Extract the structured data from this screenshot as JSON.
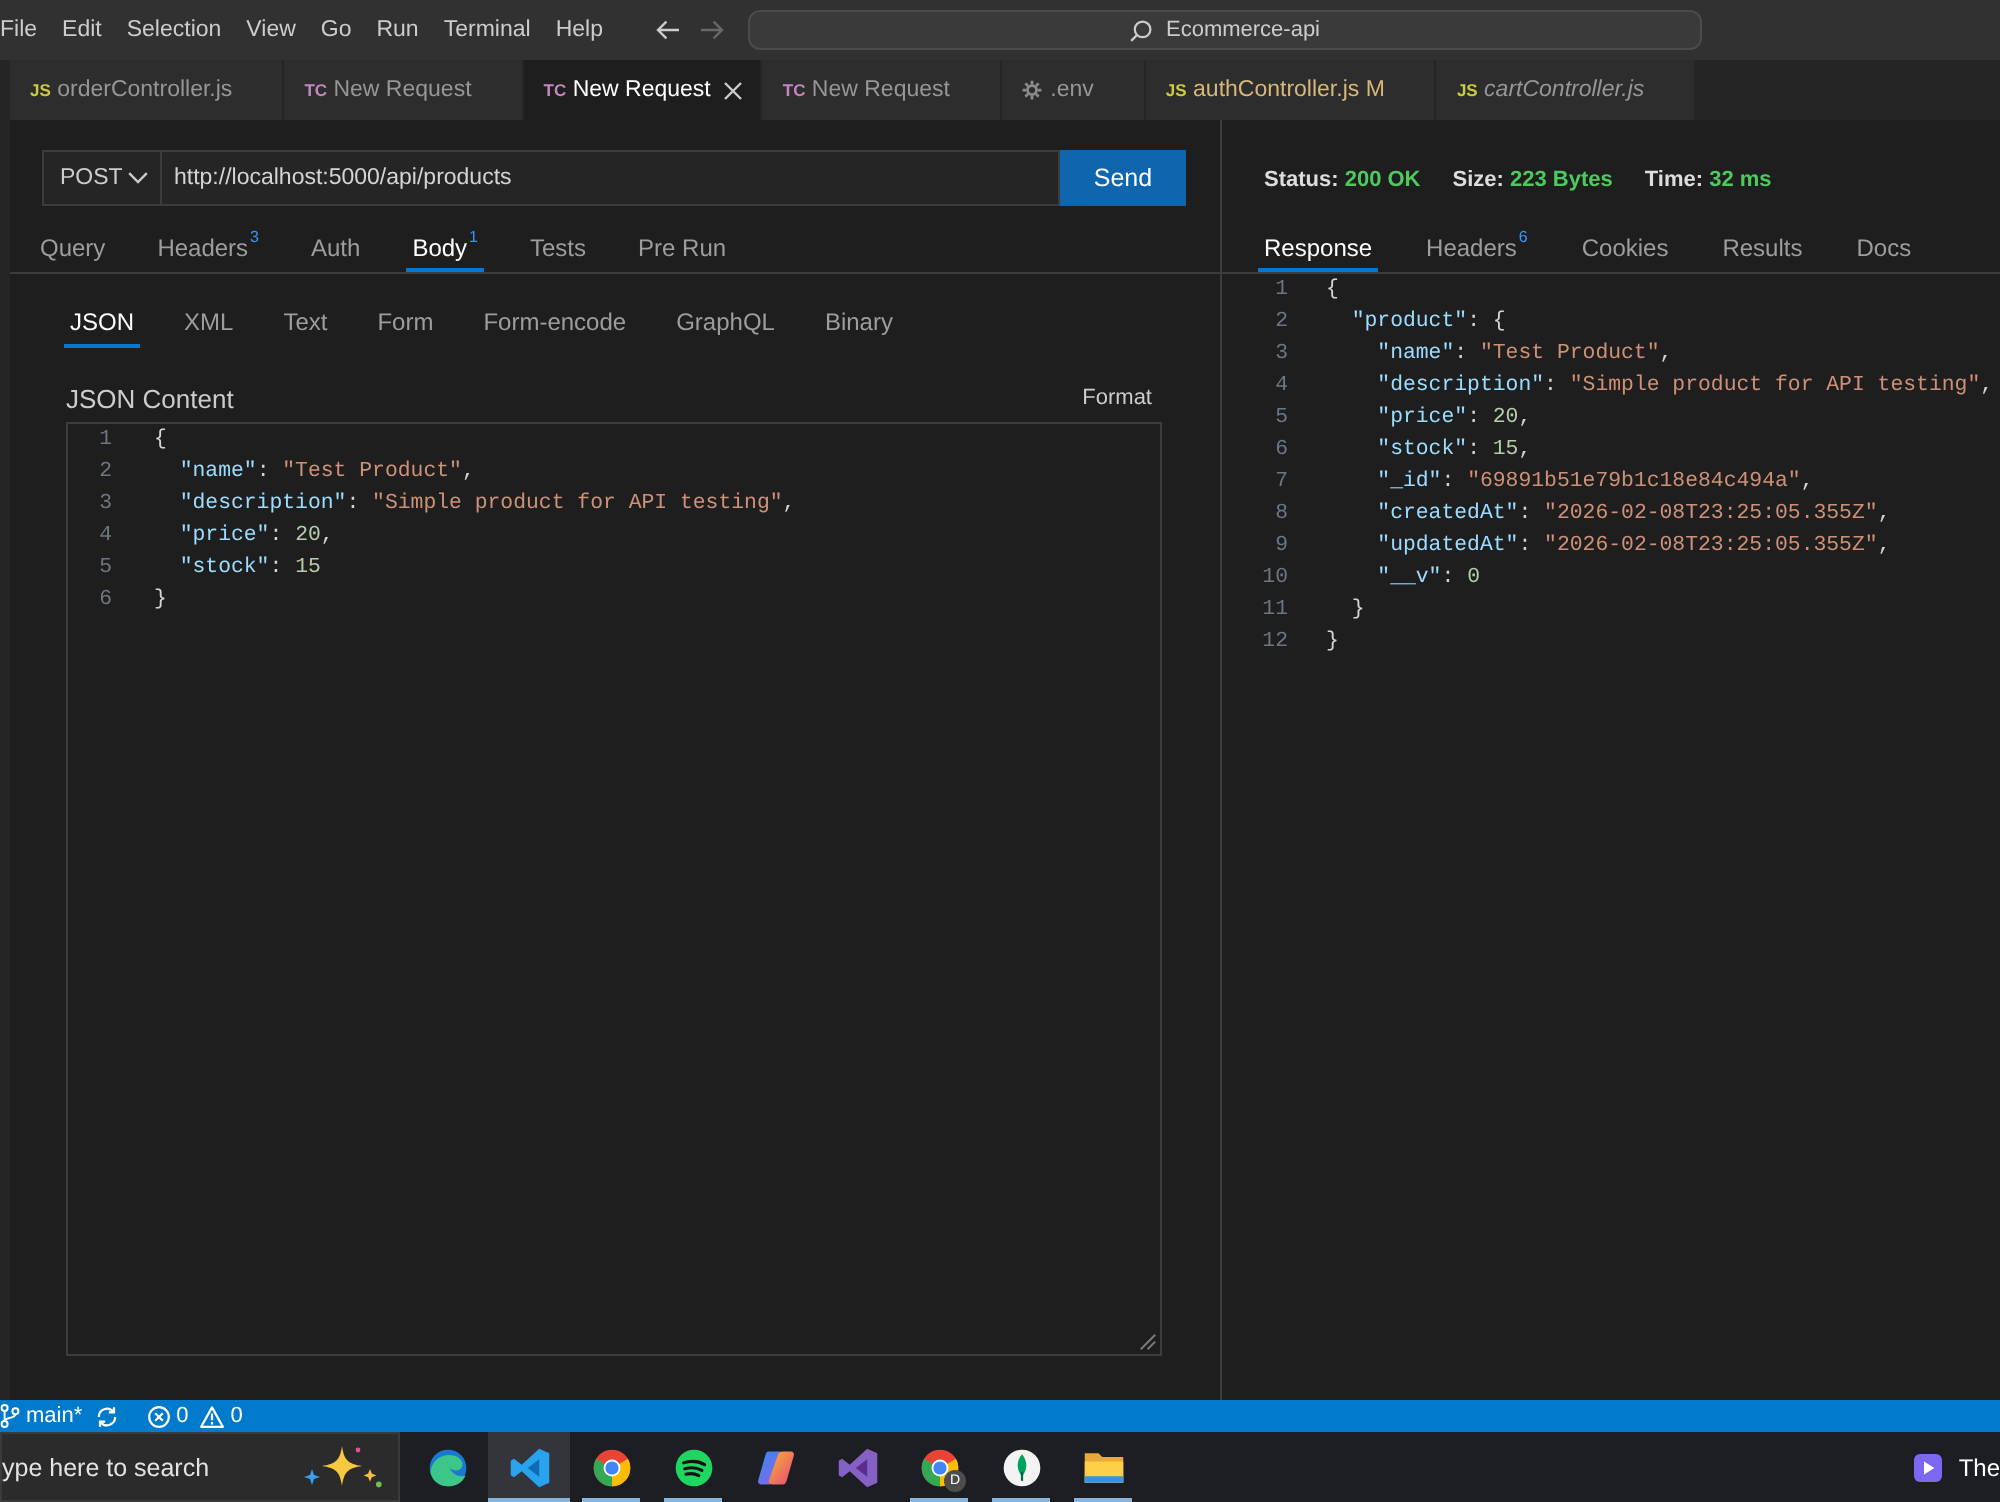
{
  "menu": [
    "File",
    "Edit",
    "Selection",
    "View",
    "Go",
    "Run",
    "Terminal",
    "Help"
  ],
  "navigation": {
    "back_disabled": false,
    "forward_disabled": true
  },
  "command_center": {
    "text": "Ecommerce-api"
  },
  "editor_tabs": [
    {
      "kind": "js",
      "badge": "JS",
      "label": "orderController.js",
      "selected": false,
      "preview": false
    },
    {
      "kind": "request",
      "badge": "TC",
      "label": "New Request",
      "selected": false,
      "preview": false
    },
    {
      "kind": "request",
      "badge": "TC",
      "label": "New Request",
      "selected": true,
      "preview": false
    },
    {
      "kind": "request",
      "badge": "TC",
      "label": "New Request",
      "selected": false,
      "preview": false
    },
    {
      "kind": "config",
      "label": ".env",
      "selected": false,
      "preview": false
    },
    {
      "kind": "js",
      "badge": "JS",
      "label": "authController.js",
      "git_status": "M",
      "selected": false,
      "preview": false
    },
    {
      "kind": "js",
      "badge": "JS",
      "label": "cartController.js",
      "selected": false,
      "preview": true
    }
  ],
  "request": {
    "method": "POST",
    "url": "http://localhost:5000/api/products",
    "send_label": "Send",
    "tabs": [
      {
        "label": "Query",
        "selected": false
      },
      {
        "label": "Headers",
        "count": "3",
        "selected": false
      },
      {
        "label": "Auth",
        "selected": false
      },
      {
        "label": "Body",
        "count": "1",
        "selected": true
      },
      {
        "label": "Tests",
        "selected": false
      },
      {
        "label": "Pre Run",
        "selected": false
      }
    ],
    "body_types": [
      {
        "label": "JSON",
        "selected": true
      },
      {
        "label": "XML",
        "selected": false
      },
      {
        "label": "Text",
        "selected": false
      },
      {
        "label": "Form",
        "selected": false
      },
      {
        "label": "Form-encode",
        "selected": false
      },
      {
        "label": "GraphQL",
        "selected": false
      },
      {
        "label": "Binary",
        "selected": false
      }
    ],
    "content_title": "JSON Content",
    "format_label": "Format",
    "lines": [
      {
        "number": "1",
        "code": "{"
      },
      {
        "number": "2",
        "code": "  \"name\": \"Test Product\","
      },
      {
        "number": "3",
        "code": "  \"description\": \"Simple product for API testing\","
      },
      {
        "number": "4",
        "code": "  \"price\": 20,"
      },
      {
        "number": "5",
        "code": "  \"stock\": 15"
      },
      {
        "number": "6",
        "code": "}"
      }
    ]
  },
  "response": {
    "stats": [
      {
        "label": "Status:",
        "value": "200 OK"
      },
      {
        "label": "Size:",
        "value": "223 Bytes"
      },
      {
        "label": "Time:",
        "value": "32 ms"
      }
    ],
    "tabs": [
      {
        "label": "Response",
        "selected": true
      },
      {
        "label": "Headers",
        "count": "6",
        "selected": false
      },
      {
        "label": "Cookies",
        "selected": false
      },
      {
        "label": "Results",
        "selected": false
      },
      {
        "label": "Docs",
        "selected": false
      }
    ],
    "lines": [
      {
        "number": "1",
        "code": "{"
      },
      {
        "number": "2",
        "code": "  \"product\": {"
      },
      {
        "number": "3",
        "code": "    \"name\": \"Test Product\","
      },
      {
        "number": "4",
        "code": "    \"description\": \"Simple product for API testing\","
      },
      {
        "number": "5",
        "code": "    \"price\": 20,"
      },
      {
        "number": "6",
        "code": "    \"stock\": 15,"
      },
      {
        "number": "7",
        "code": "    \"_id\": \"69891b51e79b1c18e84c494a\","
      },
      {
        "number": "8",
        "code": "    \"createdAt\": \"2026-02-08T23:25:05.355Z\","
      },
      {
        "number": "9",
        "code": "    \"updatedAt\": \"2026-02-08T23:25:05.355Z\","
      },
      {
        "number": "10",
        "code": "    \"__v\": 0"
      },
      {
        "number": "11",
        "code": "  }"
      },
      {
        "number": "12",
        "code": "}"
      }
    ]
  },
  "status_bar": {
    "branch": "main*",
    "errors": "0",
    "warnings": "0"
  },
  "taskbar": {
    "search": {
      "placeholder": "ype here to search"
    },
    "apps": [
      {
        "running": false,
        "active": false
      },
      {
        "running": true,
        "active": true
      },
      {
        "running": true,
        "active": false
      },
      {
        "running": true,
        "active": false
      },
      {
        "running": false,
        "active": false
      },
      {
        "running": false,
        "active": false
      },
      {
        "running": true,
        "active": false,
        "badge": "D"
      },
      {
        "running": true,
        "active": false
      },
      {
        "running": true,
        "active": false
      }
    ],
    "tray_text": "The"
  }
}
